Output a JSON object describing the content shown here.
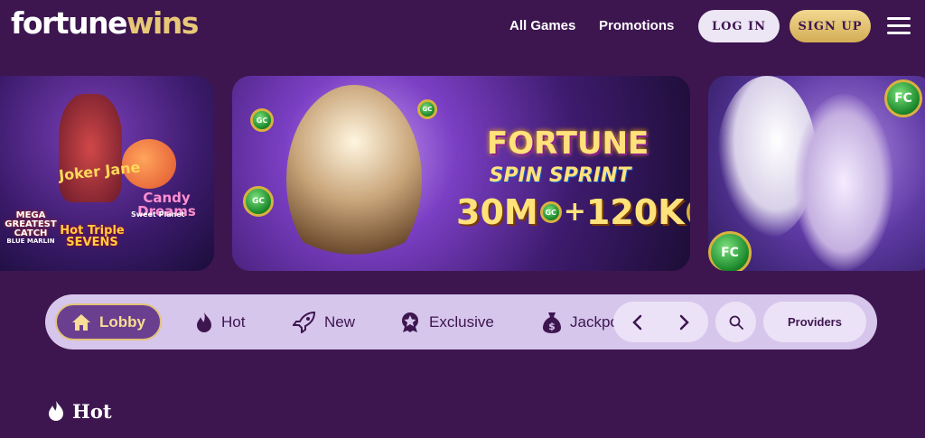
{
  "brand": {
    "logo_part1": "fortune",
    "logo_part2": "wins",
    "accent": "#e8c877",
    "background": "#3d1650"
  },
  "nav": {
    "all_games": "All Games",
    "promotions": "Promotions"
  },
  "auth": {
    "login": "LOG IN",
    "signup": "SIGN UP"
  },
  "banners": {
    "left": {
      "logos": [
        "Joker Jane",
        "Candy Dreams",
        "Sweet Planet",
        "MEGA GREATEST CATCH",
        "BLUE MARLIN",
        "Hot Triple SEVENS"
      ]
    },
    "center": {
      "title": "FORTUNE",
      "subtitle": "SPIN SPRINT",
      "offer_gc": "30M",
      "plus": "+",
      "offer_fc": "120K",
      "gc_badge": "GC",
      "fc_badge": "FC"
    },
    "right": {
      "fc_badge": "FC"
    }
  },
  "categories": {
    "lobby": "Lobby",
    "hot": "Hot",
    "new": "New",
    "exclusive": "Exclusive",
    "jackpot_partial": "Jackpot"
  },
  "controls": {
    "providers": "Providers"
  },
  "section": {
    "title": "Hot"
  }
}
